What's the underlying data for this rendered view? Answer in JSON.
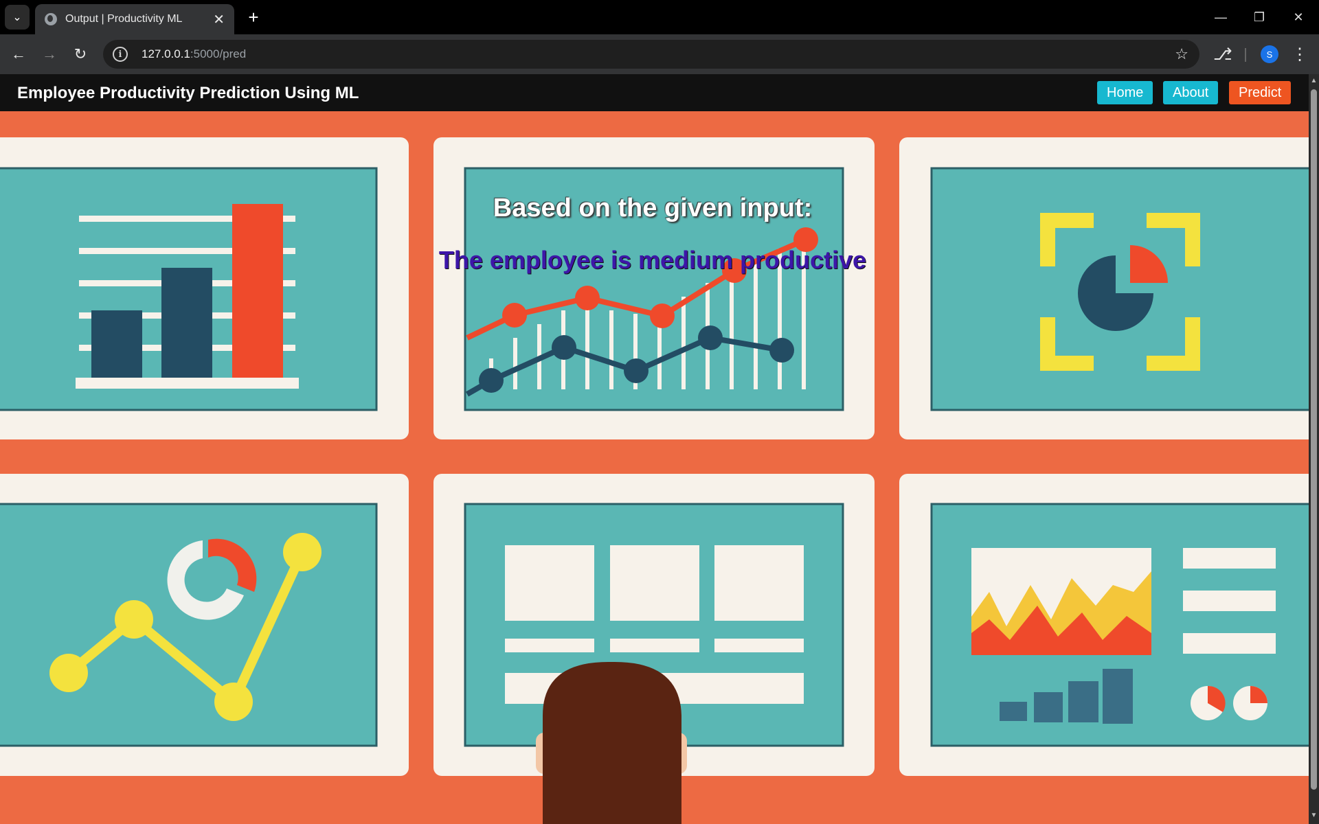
{
  "browser": {
    "tab_title": "Output | Productivity ML",
    "url_host": "127.0.0.1",
    "url_rest": ":5000/pred",
    "profile_initial": "S"
  },
  "nav": {
    "brand": "Employee Productivity Prediction Using ML",
    "home": "Home",
    "about": "About",
    "predict": "Predict"
  },
  "result": {
    "heading": "Based on the given input:",
    "prediction": "The employee is medium productive"
  },
  "colors": {
    "background": "#ed6a43",
    "nav_button": "#17b8d0",
    "predict_button": "#ee5521",
    "prediction_text": "#3d16a8"
  },
  "icons": [
    "tab-list-icon",
    "globe-icon",
    "close-icon",
    "plus-icon",
    "minimize-icon",
    "restore-icon",
    "window-close-icon",
    "back-icon",
    "forward-icon",
    "reload-icon",
    "info-icon",
    "star-icon",
    "extensions-icon",
    "menu-icon"
  ]
}
